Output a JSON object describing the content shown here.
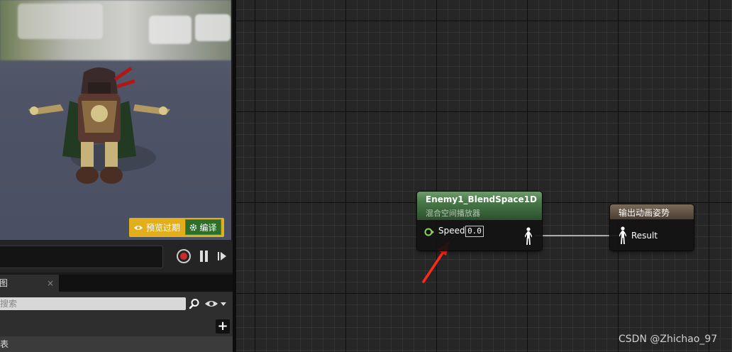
{
  "viewport": {
    "preview_status": "预览过期",
    "compile_label": "编译"
  },
  "panel": {
    "tab_label": "图",
    "tab_close": "×",
    "search_placeholder": "搜索",
    "add_label": "+",
    "list_row_label": "表"
  },
  "graph": {
    "blendspace_node": {
      "title": "Enemy1_BlendSpace1D",
      "subtitle": "混合空间播放器",
      "pin_label": "Speed",
      "pin_value": "0.0"
    },
    "output_node": {
      "title": "输出动画姿势",
      "pin_label": "Result"
    }
  },
  "watermark": "CSDN @Zhichao_97",
  "colors": {
    "blendspace_header": "#4a7a4a",
    "output_header": "#5e5143",
    "compile_button": "#2d6f2a",
    "preview_badge": "#e2ae1c",
    "annotation_arrow": "#ff2a1a",
    "record": "#cc2b2b"
  },
  "icons": [
    "eye-icon",
    "gear-icon",
    "search-icon",
    "chevron-down-icon",
    "record-icon",
    "pause-icon",
    "play-icon",
    "pose-pin-icon",
    "float-pin-icon"
  ]
}
